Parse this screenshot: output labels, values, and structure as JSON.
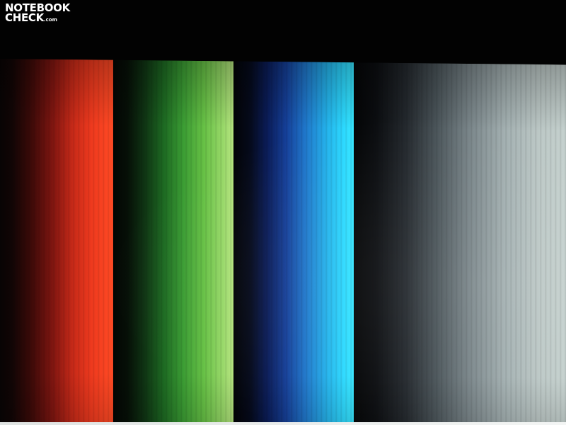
{
  "watermark": {
    "line1": "NOTEBOOK",
    "line2": "CHECK",
    "suffix": ".com"
  },
  "colors": {
    "background": "#020202",
    "red_bar_peak": "#ff4a24",
    "green_bar_peak": "#b6e480",
    "blue_bar_peak": "#38e6ff",
    "gray_bar_peak": "#c6d2cf"
  },
  "bars": [
    {
      "name": "red",
      "color": "#ff4a24"
    },
    {
      "name": "green",
      "color": "#b6e480"
    },
    {
      "name": "blue",
      "color": "#38e6ff"
    },
    {
      "name": "gray",
      "color": "#c6d2cf"
    }
  ]
}
